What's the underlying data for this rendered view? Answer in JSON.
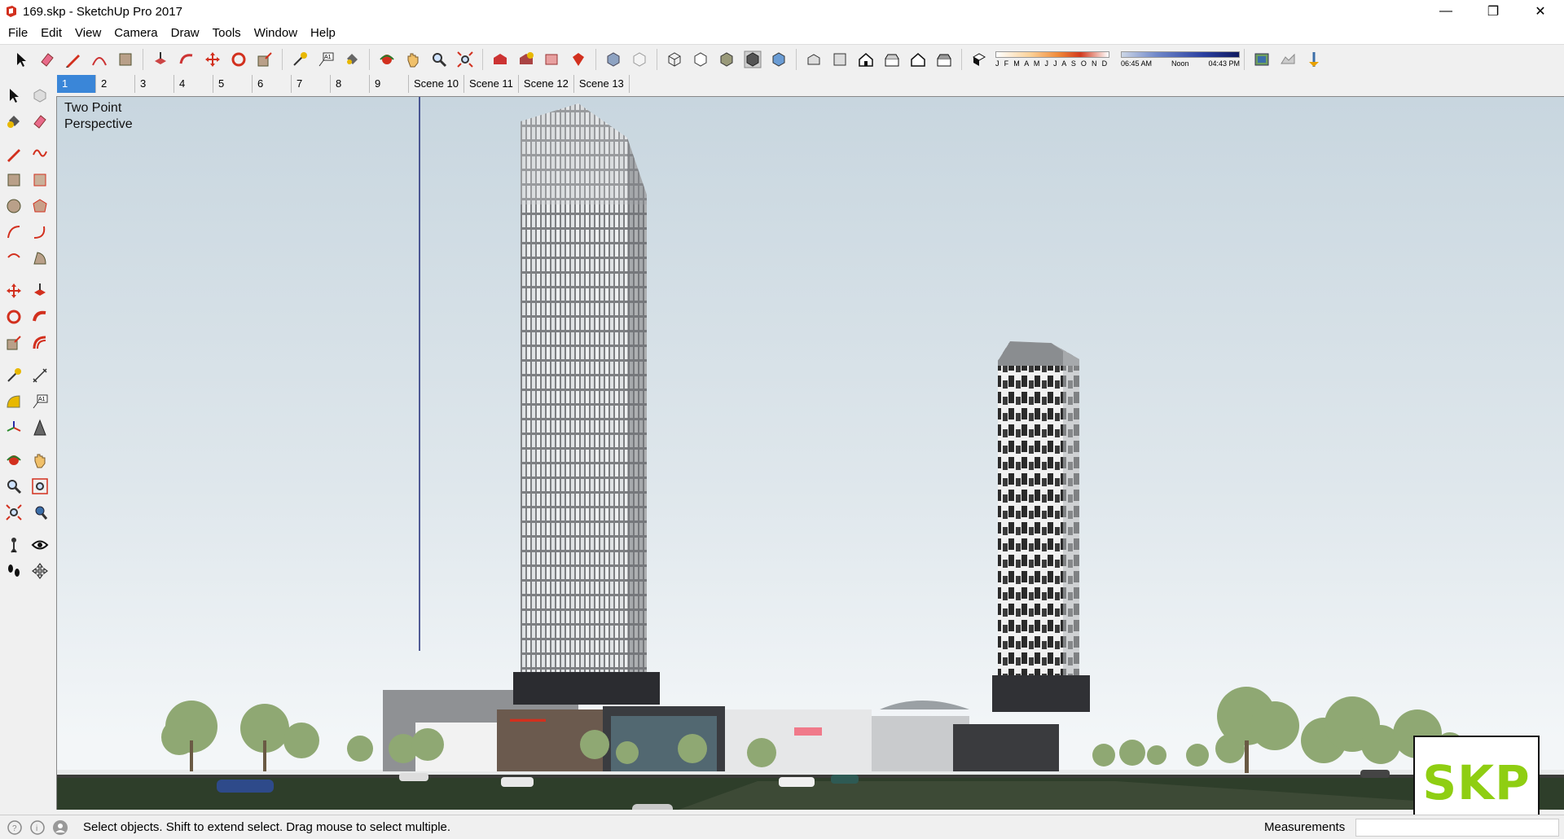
{
  "window": {
    "title": "169.skp - SketchUp Pro 2017",
    "controls": {
      "minimize": "—",
      "restore": "❐",
      "close": "✕"
    }
  },
  "menu": [
    "File",
    "Edit",
    "View",
    "Camera",
    "Draw",
    "Tools",
    "Window",
    "Help"
  ],
  "shadow_settings": {
    "months": "J F M A M J J A S O N D",
    "time_start": "06:45 AM",
    "time_mid": "Noon",
    "time_end": "04:43 PM"
  },
  "scenes": {
    "active_index": 0,
    "tabs": [
      "1",
      "2",
      "3",
      "4",
      "5",
      "6",
      "7",
      "8",
      "9",
      "Scene 10",
      "Scene 11",
      "Scene 12",
      "Scene 13"
    ]
  },
  "viewport": {
    "camera_label_line1": "Two Point",
    "camera_label_line2": "Perspective"
  },
  "status": {
    "hint": "Select objects. Shift to extend select. Drag mouse to select multiple.",
    "measurements_label": "Measurements",
    "measurements_value": ""
  },
  "watermark": "SKP",
  "colors": {
    "selection_blue": "#3a86d8",
    "logo_green": "#8fce12",
    "sketchup_red": "#d2301e"
  }
}
